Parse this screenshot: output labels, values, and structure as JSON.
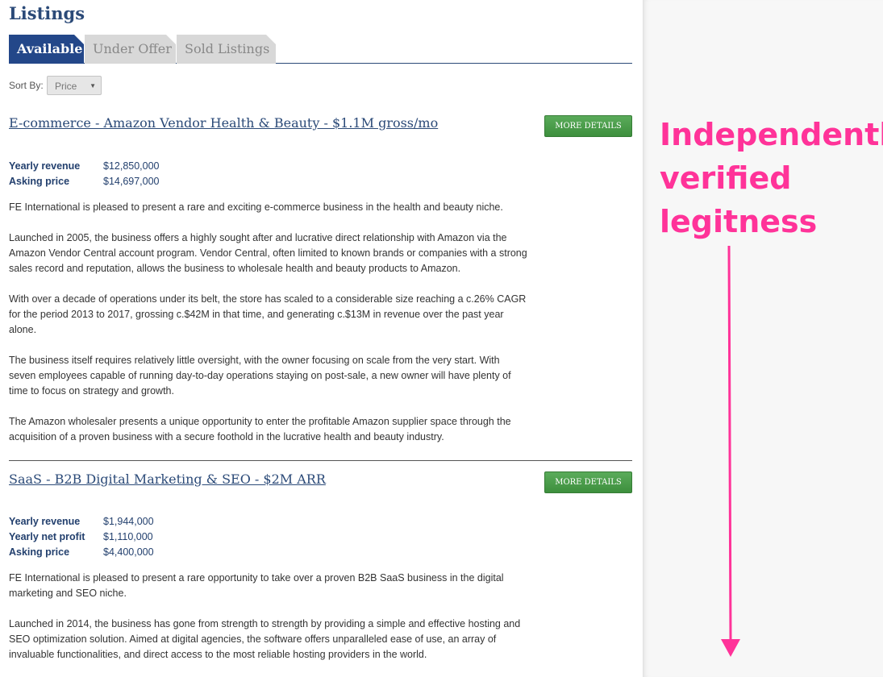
{
  "page": {
    "title": "Listings"
  },
  "tabs": [
    {
      "label": "Available",
      "active": true
    },
    {
      "label": "Under Offer",
      "active": false
    },
    {
      "label": "Sold Listings",
      "active": false
    }
  ],
  "sort": {
    "label": "Sort By:",
    "selected": "Price"
  },
  "listings": [
    {
      "title": "E-commerce - Amazon Vendor Health & Beauty - $1.1M gross/mo",
      "button": "MORE DETAILS",
      "stats": [
        {
          "label": "Yearly revenue",
          "value": "$12,850,000"
        },
        {
          "label": "Asking price",
          "value": "$14,697,000"
        }
      ],
      "paragraphs": [
        "FE International is pleased to present a rare and exciting e-commerce business in the health and beauty niche.",
        "Launched in 2005, the business offers a highly sought after and lucrative direct relationship with Amazon via the Amazon Vendor Central account program. Vendor Central, often limited to known brands or companies with a strong sales record and reputation, allows the business to wholesale health and beauty products to Amazon.",
        "With over a decade of operations under its belt, the store has scaled to a considerable size reaching a c.26% CAGR for the period 2013 to 2017, grossing c.$42M in that time, and generating c.$13M in revenue over the past year alone.",
        "The business itself requires relatively little oversight, with the owner focusing on scale from the very start. With seven employees capable of running day-to-day operations staying on post-sale, a new owner will have plenty of time to focus on strategy and growth.",
        "The Amazon wholesaler presents a unique opportunity to enter the profitable Amazon supplier space through the acquisition of a proven business with a secure foothold in the lucrative health and beauty industry."
      ]
    },
    {
      "title": "SaaS - B2B Digital Marketing & SEO - $2M ARR",
      "button": "MORE DETAILS",
      "stats": [
        {
          "label": "Yearly revenue",
          "value": "$1,944,000"
        },
        {
          "label": "Yearly net profit",
          "value": "$1,110,000"
        },
        {
          "label": "Asking price",
          "value": "$4,400,000"
        }
      ],
      "paragraphs": [
        "FE International is pleased to present a rare opportunity to take over a proven B2B SaaS business in the digital marketing and SEO niche.",
        "Launched in 2014, the business has gone from strength to strength by providing a simple and effective hosting and SEO optimization solution. Aimed at digital agencies, the software offers unparalleled ease of use, an array of invaluable functionalities, and direct access to the most reliable hosting providers in the world."
      ]
    }
  ],
  "annotation": {
    "lines": [
      "Independently",
      "verified",
      "legitness"
    ],
    "color": "#ff3399"
  }
}
